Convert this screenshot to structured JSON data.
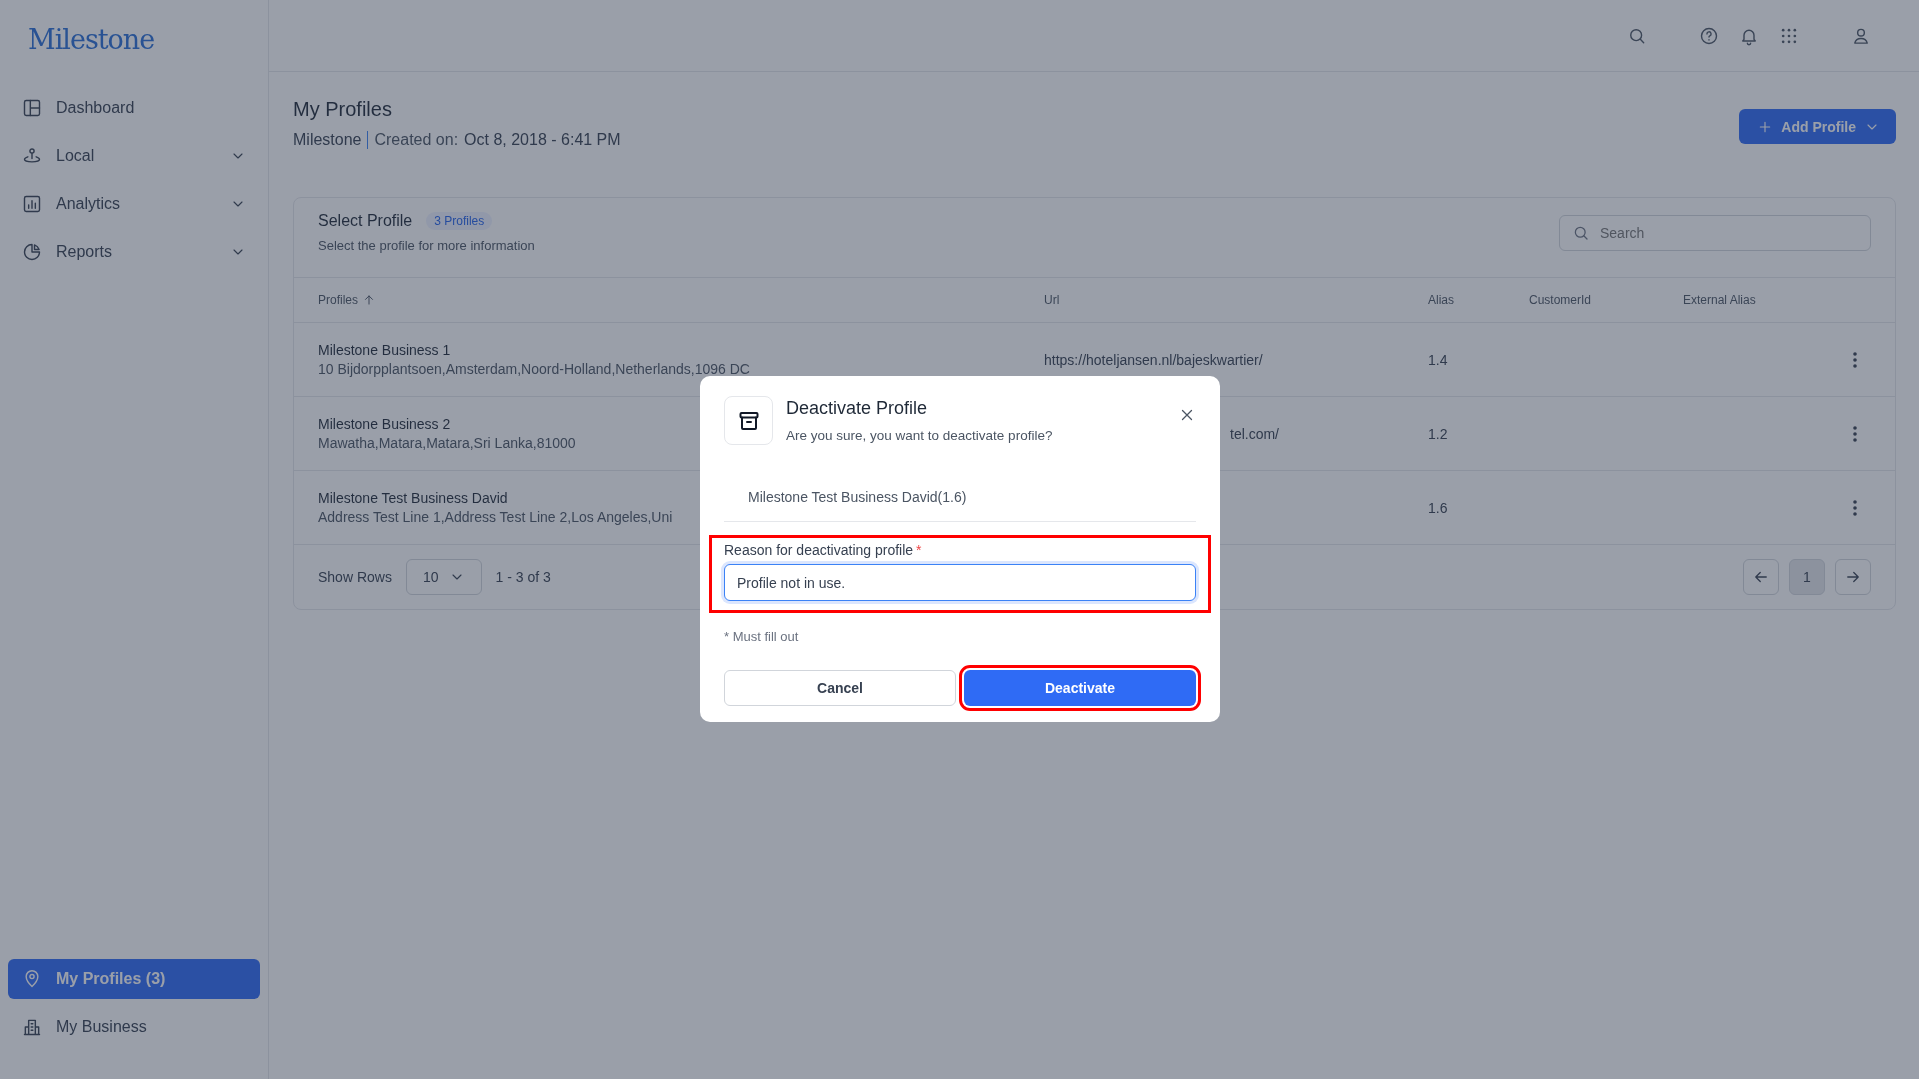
{
  "brand": {
    "logo": "Milestone"
  },
  "sidebar": {
    "items": [
      {
        "label": "Dashboard",
        "expandable": false,
        "selected": false
      },
      {
        "label": "Local",
        "expandable": true,
        "selected": false
      },
      {
        "label": "Analytics",
        "expandable": true,
        "selected": false
      },
      {
        "label": "Reports",
        "expandable": true,
        "selected": false
      }
    ],
    "bottom_items": [
      {
        "label": "My Profiles (3)",
        "selected": true
      },
      {
        "label": "My Business",
        "selected": false
      }
    ]
  },
  "page": {
    "title": "My Profiles",
    "org": "Milestone",
    "created_label": "Created on:",
    "created_value": "Oct 8, 2018 - 6:41 PM",
    "add_button": "Add Profile"
  },
  "card": {
    "title": "Select Profile",
    "badge": "3 Profiles",
    "subtitle": "Select the profile for more information",
    "search": {
      "placeholder": "Search"
    }
  },
  "table": {
    "columns": [
      {
        "label": "Profiles",
        "sorted": true
      },
      {
        "label": "Url",
        "sorted": false
      },
      {
        "label": "Alias",
        "sorted": false
      },
      {
        "label": "CustomerId",
        "sorted": false
      },
      {
        "label": "External Alias",
        "sorted": false
      }
    ],
    "rows": [
      {
        "name": "Milestone Business 1",
        "address": "10 Bijdorpplantsoen,Amsterdam,Noord-Holland,Netherlands,1096 DC",
        "url": {
          "text": "https://hoteljansen.nl/bajeskwartier/",
          "clipped": false
        },
        "alias": "1.4"
      },
      {
        "name": "Milestone Business 2",
        "address": "Mawatha,Matara,Matara,Sri Lanka,81000",
        "url": {
          "text": "tel.com/",
          "clipped": true
        },
        "alias": "1.2"
      },
      {
        "name": "Milestone Test Business David",
        "address": "Address Test Line 1,Address Test Line 2,Los Angeles,Uni",
        "alias": "1.6"
      }
    ]
  },
  "footer": {
    "show_rows_label": "Show Rows",
    "rows_per_page": "10",
    "range": "1 - 3 of 3",
    "pages": [
      {
        "label": "1",
        "selected": true
      }
    ]
  },
  "dialog": {
    "title": "Deactivate Profile",
    "message": "Are you sure, you want to deactivate profile?",
    "profile": "Milestone Test Business David(1.6)",
    "reason": {
      "label": "Reason for deactivating profile",
      "required_mark": "*",
      "value": "Profile not in use.",
      "highlighted": true
    },
    "hint": "* Must fill out",
    "buttons": [
      {
        "label": "Cancel",
        "kind": "secondary",
        "highlighted": false
      },
      {
        "label": "Deactivate",
        "kind": "primary",
        "highlighted": true
      }
    ]
  }
}
